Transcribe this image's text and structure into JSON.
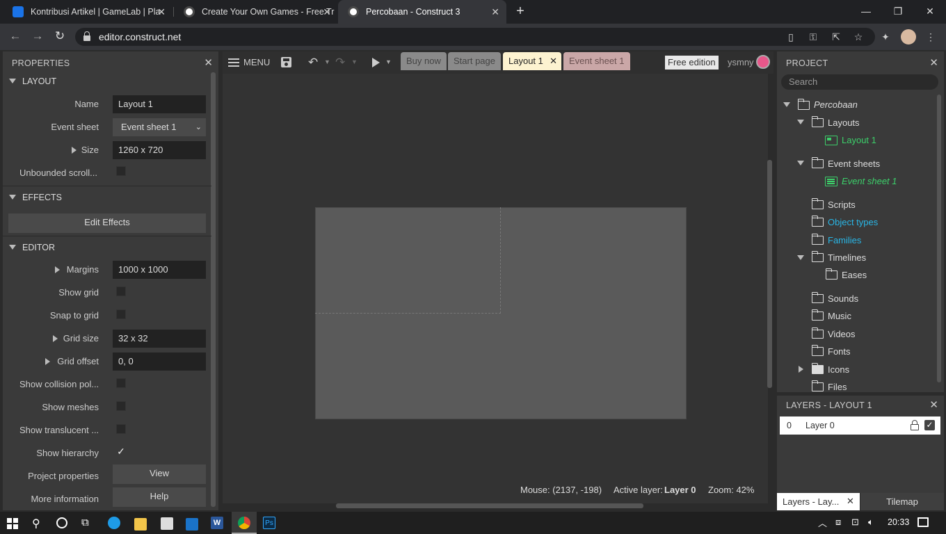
{
  "browser": {
    "tabs": [
      {
        "title": "Kontribusi Artikel | GameLab | Pla",
        "active": false
      },
      {
        "title": "Create Your Own Games - Free Tr",
        "active": false
      },
      {
        "title": "Percobaan - Construct 3",
        "active": true
      }
    ],
    "url": "editor.construct.net"
  },
  "properties": {
    "title": "PROPERTIES",
    "sections": {
      "layout": "LAYOUT",
      "effects": "EFFECTS",
      "editor": "EDITOR"
    },
    "layout": {
      "name_label": "Name",
      "name_value": "Layout 1",
      "event_sheet_label": "Event sheet",
      "event_sheet_value": "Event sheet 1",
      "size_label": "Size",
      "size_value": "1260 x 720",
      "unbounded_label": "Unbounded scroll...",
      "unbounded_checked": false
    },
    "effects": {
      "edit_button": "Edit Effects"
    },
    "editor": {
      "margins_label": "Margins",
      "margins_value": "1000 x 1000",
      "show_grid_label": "Show grid",
      "snap_label": "Snap to grid",
      "grid_size_label": "Grid size",
      "grid_size_value": "32 x 32",
      "grid_offset_label": "Grid offset",
      "grid_offset_value": "0, 0",
      "collision_label": "Show collision pol...",
      "meshes_label": "Show meshes",
      "translucent_label": "Show translucent ...",
      "hierarchy_label": "Show hierarchy",
      "hierarchy_checked": true,
      "project_props_label": "Project properties",
      "view_button": "View",
      "more_info_label": "More information",
      "help_button": "Help"
    }
  },
  "center": {
    "menu_label": "MENU",
    "tabs": {
      "buy": "Buy now",
      "start": "Start page",
      "layout": "Layout 1",
      "events": "Event sheet 1"
    },
    "free_edition": "Free edition",
    "user": "ysmny",
    "status": {
      "mouse": "Mouse: (2137, -198)",
      "active_layer_label": "Active layer:",
      "active_layer_value": "Layer 0",
      "zoom": "Zoom: 42%"
    }
  },
  "project": {
    "title": "PROJECT",
    "search_placeholder": "Search",
    "root": "Percobaan",
    "layouts": "Layouts",
    "layout1": "Layout 1",
    "event_sheets": "Event sheets",
    "event_sheet1": "Event sheet 1",
    "scripts": "Scripts",
    "object_types": "Object types",
    "families": "Families",
    "timelines": "Timelines",
    "eases": "Eases",
    "sounds": "Sounds",
    "music": "Music",
    "videos": "Videos",
    "fonts": "Fonts",
    "icons": "Icons",
    "files": "Files"
  },
  "layers": {
    "title": "LAYERS - LAYOUT 1",
    "row_index": "0",
    "row_name": "Layer 0",
    "bottom_tab_layers": "Layers - Lay...",
    "bottom_tab_tilemap": "Tilemap"
  },
  "taskbar": {
    "clock": "20:33"
  },
  "colors": {
    "accent_green": "#3ccf6a",
    "accent_blue": "#29b6e6",
    "layout_tab_bg": "#fdf3d0",
    "events_tab_bg": "#caa7a7"
  }
}
